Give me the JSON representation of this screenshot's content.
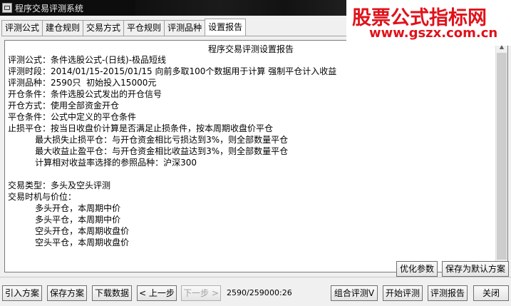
{
  "window": {
    "title": "程序交易评测系统"
  },
  "watermark": {
    "title": "股票公式指标网",
    "url": "www.gszx.com.cn"
  },
  "tabs": [
    {
      "label": "评测公式"
    },
    {
      "label": "建仓规则"
    },
    {
      "label": "交易方式"
    },
    {
      "label": "平仓规则"
    },
    {
      "label": "评测品种"
    },
    {
      "label": "设置报告"
    }
  ],
  "active_tab": "设置报告",
  "report": {
    "heading": "程序交易评测设置报告",
    "lines": [
      "评测公式：条件选股公式-(日线)-极品短线",
      "评测时段：2014/01/15-2015/01/15 向前多取100个数据用于计算 强制平仓计入收益",
      "评测品种：2590只  初始投入15000元",
      "开仓条件：条件选股公式发出的开仓信号",
      "开仓方式：使用全部资金开仓",
      "平仓条件：公式中定义的平仓条件",
      "止损平仓：按当日收盘价计算是否满足止损条件，按本周期收盘价平仓",
      "          最大损失止损平仓：与开仓资金相比亏损达到3%，则全部数量平仓",
      "          最大收益止盈平仓：与开仓资金相比收益达到3%，则全部数量平仓",
      "          计算相对收益率选择的参照品种：沪深300",
      "",
      "交易类型：多头及空头评测",
      "交易时机与价位：",
      "          多头开仓，本周期中价",
      "          多头平仓，本周期中价",
      "          空头开仓，本周期收盘价",
      "          空头平仓，本周期收盘价"
    ]
  },
  "actions": {
    "optimize": "优化参数",
    "save_default": "保存为默认方案"
  },
  "toolbar": {
    "import": "引入方案",
    "save": "保存方案",
    "download": "下载数据",
    "prev": "< 上一步",
    "next": "下一步 >",
    "progress": "2590/2590",
    "elapsed": "00:26",
    "combo": "组合评测V",
    "start": "开始评测",
    "report": "评测报告",
    "close": "关闭"
  }
}
